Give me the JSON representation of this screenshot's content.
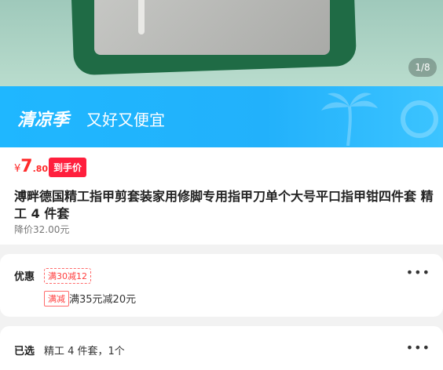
{
  "hero": {
    "image_counter": "1/8"
  },
  "banner": {
    "brand": "清凉季",
    "slogan": "又好又便宜"
  },
  "price": {
    "currency": "¥",
    "integer": "7",
    "decimal": ".80",
    "tag": "到手价"
  },
  "product": {
    "title": "溥畔德国精工指甲剪套装家用修脚专用指甲刀单个大号平口指甲钳四件套 精工 4 件套",
    "original_price": "降价32.00元"
  },
  "offers": {
    "label": "优惠",
    "coupon": "满30减12",
    "promo_tag": "满减",
    "promo_text": "满35元减20元"
  },
  "selection": {
    "label": "已选",
    "value": "精工 4 件套，1个"
  },
  "colors": {
    "accent_red": "#ff1f3d",
    "banner_blue": "#22b1fb"
  }
}
